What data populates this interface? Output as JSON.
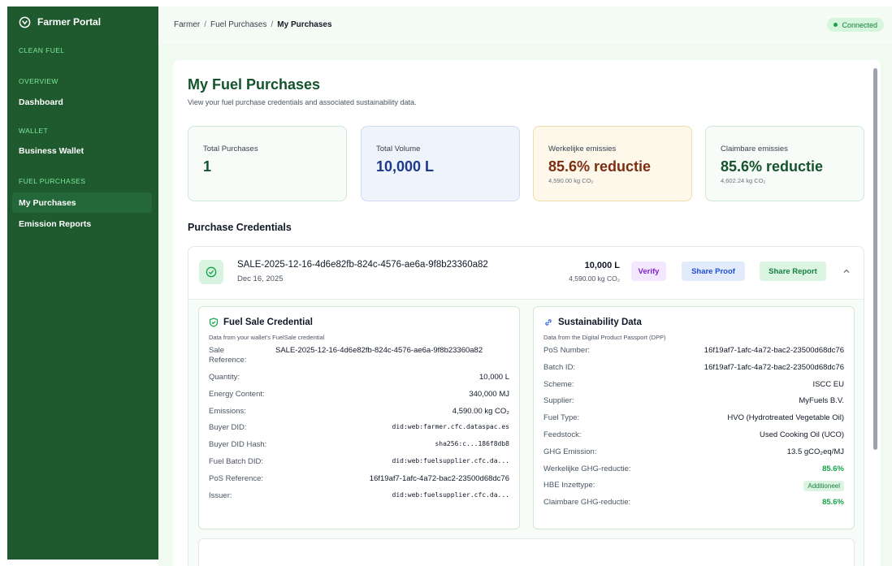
{
  "sidebar": {
    "brand": "Farmer Portal",
    "section_top": "CLEAN FUEL",
    "sections": [
      {
        "label": "OVERVIEW",
        "items": [
          "Dashboard"
        ]
      },
      {
        "label": "WALLET",
        "items": [
          "Business Wallet"
        ]
      },
      {
        "label": "FUEL PURCHASES",
        "items": [
          "My Purchases",
          "Emission Reports"
        ]
      }
    ],
    "active_item": "My Purchases"
  },
  "topbar": {
    "breadcrumb": [
      "Farmer",
      "Fuel Purchases",
      "My Purchases"
    ],
    "breadcrumb_sep": "/",
    "status": "Connected"
  },
  "page": {
    "title": "My Fuel Purchases",
    "subtitle": "View your fuel purchase credentials and associated sustainability data."
  },
  "stats": [
    {
      "label": "Total Purchases",
      "value": "1",
      "sub": ""
    },
    {
      "label": "Total Volume",
      "value": "10,000 L",
      "sub": ""
    },
    {
      "label": "Werkelijke emissies",
      "value": "85.6% reductie",
      "sub": "4,590.00 kg CO₂"
    },
    {
      "label": "Claimbare emissies",
      "value": "85.6% reductie",
      "sub": "4,602.24 kg CO₂"
    }
  ],
  "section_title": "Purchase Credentials",
  "credential": {
    "id": "SALE-2025-12-16-4d6e82fb-824c-4576-ae6a-9f8b23360a82",
    "date": "Dec 16, 2025",
    "volume": "10,000 L",
    "emissions": "4,590.00 kg CO₂",
    "buttons": {
      "verify": "Verify",
      "share_proof": "Share Proof",
      "share_report": "Share Report"
    },
    "fuel_sale": {
      "title": "Fuel Sale Credential",
      "desc": "Data from your wallet's FuelSale credential",
      "sale_ref_label": "Sale Reference:",
      "sale_ref_value": "SALE-2025-12-16-4d6e82fb-824c-4576-ae6a-9f8b23360a82",
      "rows": [
        {
          "k": "Quantity:",
          "v": "10,000 L",
          "mono": false
        },
        {
          "k": "Energy Content:",
          "v": "340,000 MJ",
          "mono": false
        },
        {
          "k": "Emissions:",
          "v": "4,590.00 kg CO₂",
          "mono": false
        },
        {
          "k": "Buyer DID:",
          "v": "did:web:farmer.cfc.dataspac.es",
          "mono": true
        },
        {
          "k": "Buyer DID Hash:",
          "v": "sha256:c...186f8db8",
          "mono": true
        },
        {
          "k": "Fuel Batch DID:",
          "v": "did:web:fuelsupplier.cfc.da...",
          "mono": true
        },
        {
          "k": "PoS Reference:",
          "v": "16f19af7-1afc-4a72-bac2-23500d68dc76",
          "mono": false
        },
        {
          "k": "Issuer:",
          "v": "did:web:fuelsupplier.cfc.da...",
          "mono": true
        }
      ]
    },
    "sustainability": {
      "title": "Sustainability Data",
      "desc": "Data from the Digital Product Passport (DPP)",
      "rows": [
        {
          "k": "PoS Number:",
          "v": "16f19af7-1afc-4a72-bac2-23500d68dc76"
        },
        {
          "k": "Batch ID:",
          "v": "16f19af7-1afc-4a72-bac2-23500d68dc76"
        },
        {
          "k": "Scheme:",
          "v": "ISCC EU"
        },
        {
          "k": "Supplier:",
          "v": "MyFuels B.V."
        },
        {
          "k": "Fuel Type:",
          "v": "HVO (Hydrotreated Vegetable Oil)"
        },
        {
          "k": "Feedstock:",
          "v": "Used Cooking Oil (UCO)"
        },
        {
          "k": "GHG Emission:",
          "v": "13.5 gCO₂eq/MJ"
        }
      ],
      "werkelijke_label": "Werkelijke GHG-reductie:",
      "werkelijke_value": "85.6%",
      "hbe_label": "HBE Inzettype:",
      "hbe_value": "Additioneel",
      "claimbare_label": "Claimbare GHG-reductie:",
      "claimbare_value": "85.6%"
    }
  },
  "colors": {
    "sidebar_bg": "#1f5a2e",
    "accent_green": "#16a34a",
    "verify_purple": "#7e22ce",
    "share_blue": "#1d4ed8"
  }
}
